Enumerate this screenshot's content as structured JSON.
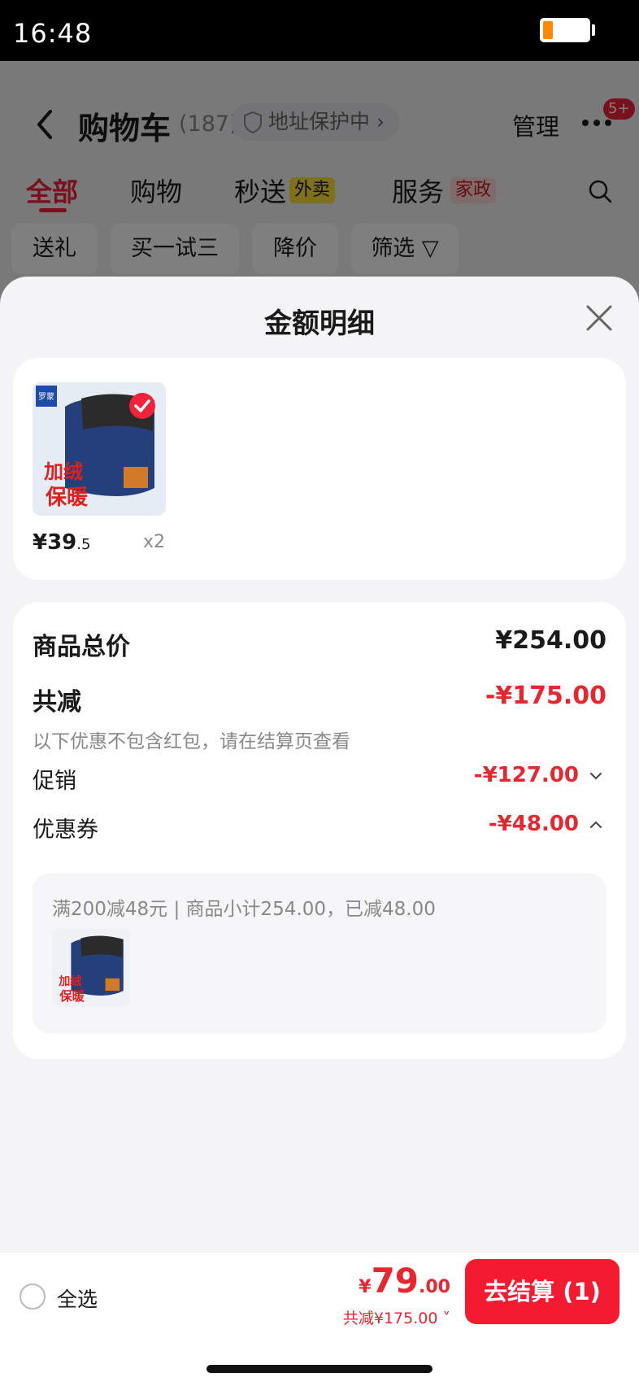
{
  "status_bar": {
    "time": "16:48"
  },
  "cart": {
    "title": "购物车",
    "count": "(187)",
    "address_chip": "地址保护中",
    "manage": "管理",
    "badge": "5+",
    "tabs": [
      {
        "label": "全部",
        "active": true
      },
      {
        "label": "购物"
      },
      {
        "label": "秒送",
        "tag": "外卖"
      },
      {
        "label": "服务",
        "tag": "家政"
      }
    ],
    "filters": [
      "送礼",
      "买一试三",
      "降价",
      "筛选"
    ]
  },
  "sheet": {
    "title": "金额明细",
    "item": {
      "image_text_top": "加绒",
      "image_text_bottom": "保暖",
      "brand": "罗蒙",
      "price_int": "¥39",
      "price_dec": ".5",
      "qty": "x2"
    },
    "summary": {
      "goods_total_label": "商品总价",
      "goods_total_value": "¥254.00",
      "total_reduce_label": "共减",
      "total_reduce_value": "-¥175.00",
      "note": "以下优惠不包含红包，请在结算页查看",
      "promo_label": "促销",
      "promo_value": "-¥127.00",
      "coupon_label": "优惠券",
      "coupon_value": "-¥48.00",
      "coupon_detail": "满200减48元 | 商品小计254.00，已减48.00"
    }
  },
  "bottom_bar": {
    "select_all": "全选",
    "price_yen": "¥",
    "price_int": "79",
    "price_dec": ".00",
    "discount": "共减¥175.00",
    "checkout": "去结算 (1)"
  },
  "colors": {
    "accent": "#e8262f",
    "button": "#f41a2f"
  }
}
